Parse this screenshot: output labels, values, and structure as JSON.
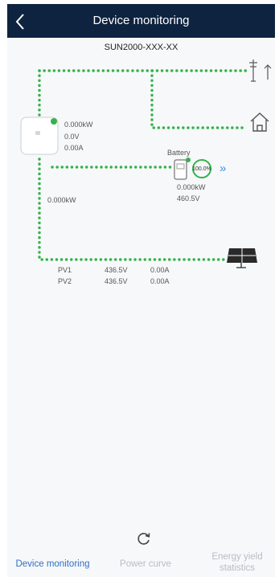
{
  "header": {
    "title": "Device monitoring"
  },
  "device": {
    "name": "SUN2000-XXX-XX"
  },
  "inverter": {
    "power": "0.000kW",
    "voltage": "0.0V",
    "current": "0.00A"
  },
  "battery": {
    "label": "Battery",
    "soc": "100.0%",
    "power": "0.000kW",
    "voltage": "460.5V"
  },
  "pv_flow": {
    "power": "0.000kW"
  },
  "pv_strings": [
    {
      "name": "PV1",
      "voltage": "436.5V",
      "current": "0.00A"
    },
    {
      "name": "PV2",
      "voltage": "436.5V",
      "current": "0.00A"
    }
  ],
  "tabs": [
    {
      "label": "Device monitoring"
    },
    {
      "label": "Power curve"
    },
    {
      "label": "Energy yield statistics"
    }
  ],
  "colors": {
    "header_bg": "#0e2340",
    "flow": "#34b24a",
    "tab_active": "#2f6fc4",
    "tab_inactive": "#b8bcc3",
    "battery_expand": "#3a8ee6"
  },
  "icons": [
    "back-icon",
    "grid-tower-icon",
    "home-icon",
    "inverter-icon",
    "battery-icon",
    "solar-panel-icon",
    "refresh-icon",
    "expand-icon"
  ]
}
